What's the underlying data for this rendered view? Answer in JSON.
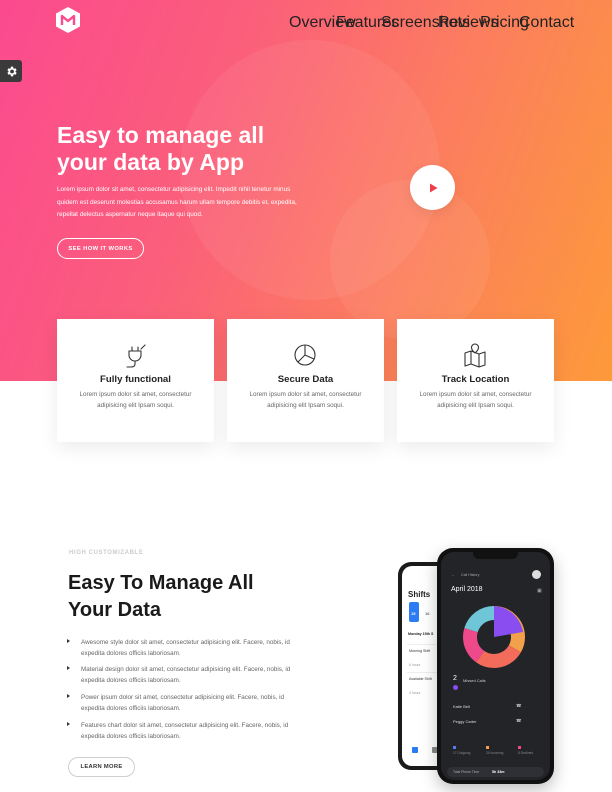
{
  "nav": {
    "links": [
      "Overview",
      "Features",
      "Screenshots",
      "Reviews",
      "Pricing",
      "Contact"
    ]
  },
  "hero": {
    "title_line1": "Easy to manage all",
    "title_line2": "your data by App",
    "text": "Lorem ipsum dolor sit amet, consectetur adipisicing elit. Impedit nihil tenetur minus quidem est deserunt molestias accusamus harum ullam tempore debitis et, expedita, repellat delectus aspernatur neque itaque qui quod.",
    "cta": "SEE HOW IT WORKS"
  },
  "cards": [
    {
      "icon": "plug-icon",
      "title": "Fully functional",
      "text": "Lorem ipsum dolor sit amet, consectetur adipisicing elit Ipsam soqui."
    },
    {
      "icon": "pie-chart-icon",
      "title": "Secure Data",
      "text": "Lorem ipsum dolor sit amet, consectetur adipisicing elit Ipsam soqui."
    },
    {
      "icon": "map-pin-icon",
      "title": "Track Location",
      "text": "Lorem ipsum dolor sit amet, consectetur adipisicing elit Ipsam soqui."
    }
  ],
  "features": {
    "kicker": "HIGH CUSTOMIZABLE",
    "title_line1": "Easy To Manage All",
    "title_line2": "Your Data",
    "items": [
      "Awesome style dolor sit amet, consectetur adipisicing elit. Facere, nobis, id expedita dolores officiis laboriosam.",
      "Material design dolor sit amet, consectetur adipisicing elit. Facere, nobis, id expedita dolores officiis laboriosam.",
      "Power ipsum dolor sit amet, consectetur adipisicing elit. Facere, nobis, id expedita dolores officiis laboriosam.",
      "Features chart dolor sit amet, consectetur adipisicing elit. Facere, nobis, id expedita dolores officiis laboriosam."
    ],
    "cta": "LEARN MORE"
  },
  "phone_back": {
    "title": "Shifts",
    "day_num": "15",
    "day_next": "16",
    "section": "Monday 15th S",
    "shift1": "Morning Shift",
    "shift1_hours": "6 hours",
    "shift2": "Available Shift",
    "shift2_hours": "4 hours"
  },
  "phone_front": {
    "header": "Call History",
    "month": "April 2018",
    "missed_count": "2",
    "missed_label": "Missed Calls",
    "contact1": "Katie Bell",
    "contact2": "Peggy Carter",
    "legend1": "17 Outgoing",
    "legend2": "24 Incoming",
    "legend3": "8 Declined",
    "footer_label": "Total Phone Time",
    "footer_value": "5h 33m"
  },
  "colors": {
    "gradient_start": "#fb4a8f",
    "gradient_end": "#fd9a3a",
    "play_red": "#ef3e4a"
  }
}
